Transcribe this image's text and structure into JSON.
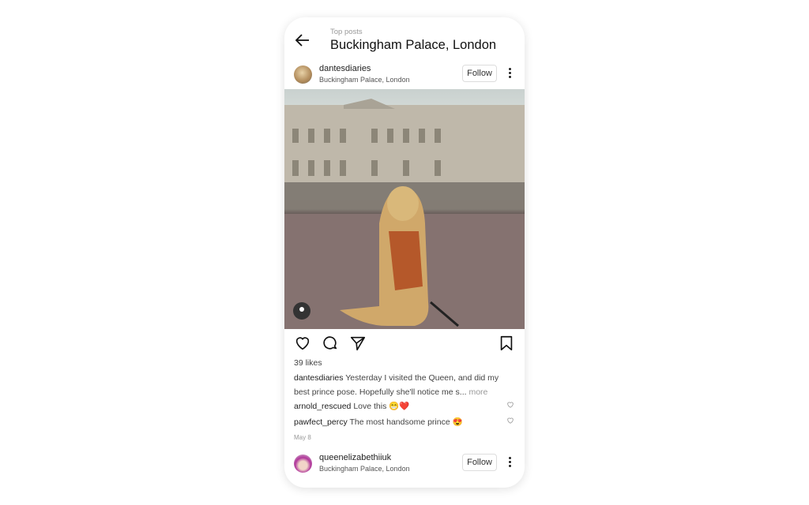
{
  "header": {
    "subtitle": "Top posts",
    "title": "Buckingham Palace, London"
  },
  "posts": [
    {
      "username": "dantesdiaries",
      "location": "Buckingham Palace, London",
      "follow_label": "Follow",
      "likes": "39 likes",
      "caption_user": "dantesdiaries",
      "caption": "Yesterday I visited the Queen, and did my best prince pose. Hopefully she'll notice me s...",
      "more_label": "more",
      "comments": [
        {
          "user": "arnold_rescued",
          "text": "Love this 😁❤️"
        },
        {
          "user": "pawfect_percy",
          "text": "The most handsome prince 😍"
        }
      ],
      "date": "May 8"
    },
    {
      "username": "queenelizabethiiuk",
      "location": "Buckingham Palace, London",
      "follow_label": "Follow"
    }
  ],
  "colors": {
    "accent": "#222222",
    "muted": "#999999"
  }
}
